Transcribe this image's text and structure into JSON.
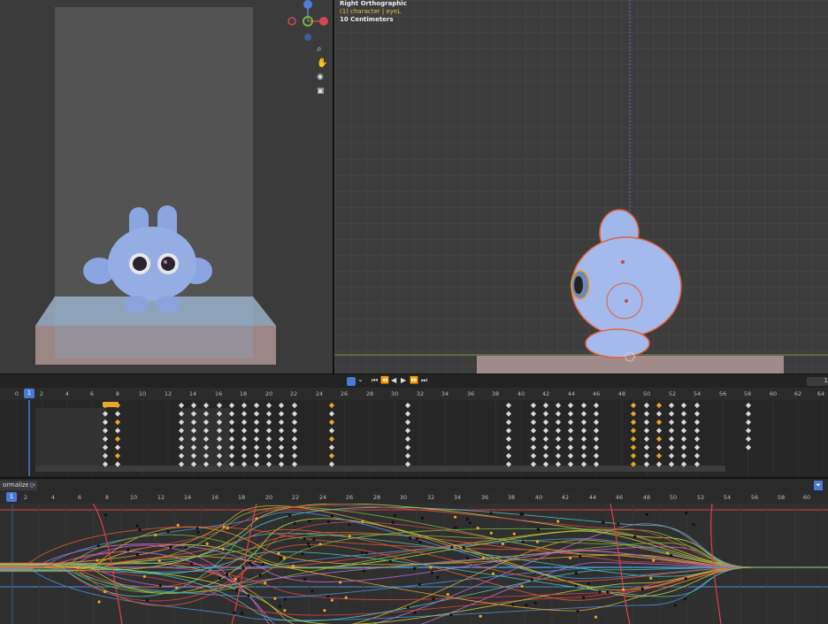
{
  "viewport_right": {
    "view_name": "Right Orthographic",
    "object_info": "(1) character | eyeL",
    "scale": "10 Centimeters"
  },
  "gizmo": {
    "axis_z": "Z",
    "axis_x": "X",
    "axis_y": "Y"
  },
  "timeline": {
    "current_frame": "1",
    "frame_labels": [
      "0",
      "2",
      "4",
      "6",
      "8",
      "10",
      "12",
      "14",
      "16",
      "18",
      "20",
      "22",
      "24",
      "26",
      "28",
      "30",
      "32",
      "34",
      "36",
      "38",
      "40",
      "42",
      "44",
      "46",
      "48",
      "50",
      "52",
      "54",
      "56",
      "58",
      "60",
      "62",
      "64"
    ],
    "right_field": "1"
  },
  "graph_editor": {
    "normalize_label": "ormalize",
    "current_frame": "1",
    "frame_labels": [
      "2",
      "4",
      "6",
      "8",
      "10",
      "12",
      "14",
      "16",
      "18",
      "20",
      "22",
      "24",
      "26",
      "28",
      "30",
      "32",
      "34",
      "36",
      "38",
      "40",
      "42",
      "44",
      "46",
      "48",
      "50",
      "52",
      "54",
      "56",
      "58",
      "60"
    ]
  },
  "colors": {
    "accent": "#4b7bd6",
    "key_selected": "#e8a62a",
    "curve_red": "#d9434a",
    "curve_green": "#7cb33a",
    "curve_blue": "#4a8fd8"
  }
}
